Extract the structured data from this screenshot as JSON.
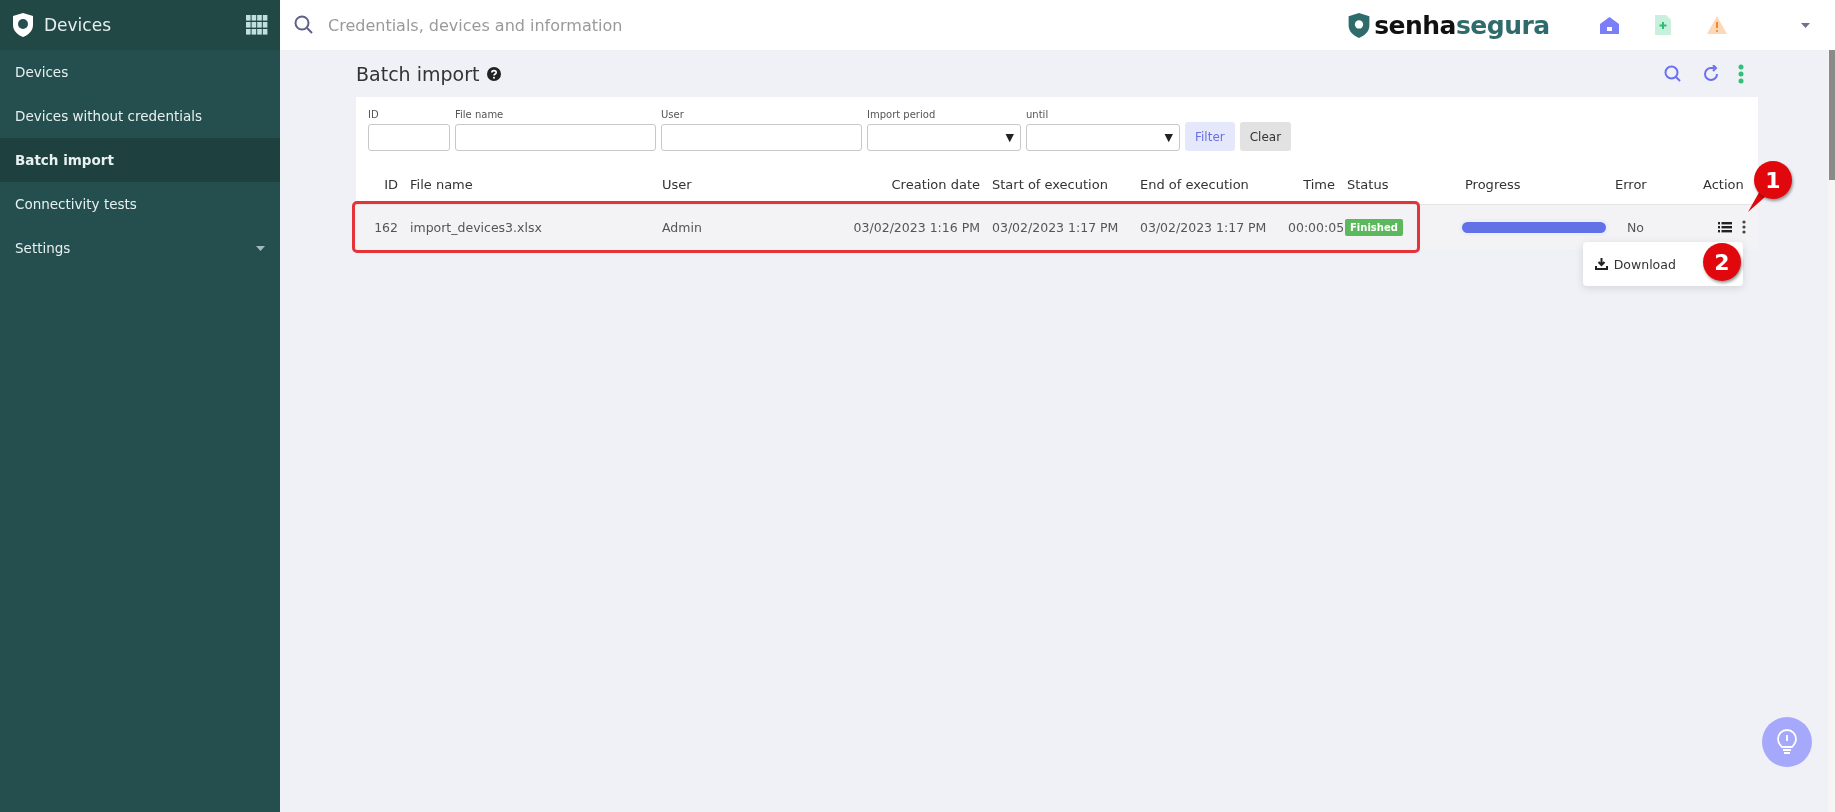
{
  "sidebar": {
    "title": "Devices",
    "items": [
      {
        "label": "Devices",
        "selected": false,
        "expandable": false
      },
      {
        "label": "Devices without credentials",
        "selected": false,
        "expandable": false
      },
      {
        "label": "Batch import",
        "selected": true,
        "expandable": false
      },
      {
        "label": "Connectivity tests",
        "selected": false,
        "expandable": false
      },
      {
        "label": "Settings",
        "selected": false,
        "expandable": true
      }
    ]
  },
  "topbar": {
    "search_placeholder": "Credentials, devices and information",
    "brand": {
      "part_1": "senha",
      "part_2": "segura"
    }
  },
  "page": {
    "title": "Batch import"
  },
  "filters": {
    "fields": [
      {
        "kind": "text",
        "label": "ID"
      },
      {
        "kind": "text",
        "label": "File name"
      },
      {
        "kind": "text",
        "label": "User"
      },
      {
        "kind": "select",
        "label": "Import period",
        "caret": "▼"
      },
      {
        "kind": "select",
        "label": "until",
        "caret": "▼"
      }
    ],
    "buttons": [
      {
        "kind": "primary",
        "label": "Filter"
      },
      {
        "kind": "secondary",
        "label": "Clear"
      }
    ]
  },
  "table": {
    "columns": [
      "ID",
      "File name",
      "User",
      "Creation date",
      "Start of execution",
      "End of execution",
      "Time",
      "Status",
      "Progress",
      "Error",
      "Action"
    ],
    "rows": [
      {
        "id": "162",
        "file_name": "import_devices3.xlsx",
        "user": "Admin",
        "creation_date": "03/02/2023 1:16 PM",
        "start": "03/02/2023 1:17 PM",
        "end": "03/02/2023 1:17 PM",
        "time": "00:00:05",
        "status": "Finished",
        "progress": {
          "level": 1
        },
        "error": "No",
        "highlighted": true,
        "menu_open": true
      }
    ]
  },
  "action_menu": {
    "items": [
      "Download"
    ]
  },
  "annotations": [
    {
      "label": "1"
    },
    {
      "label": "2"
    }
  ]
}
